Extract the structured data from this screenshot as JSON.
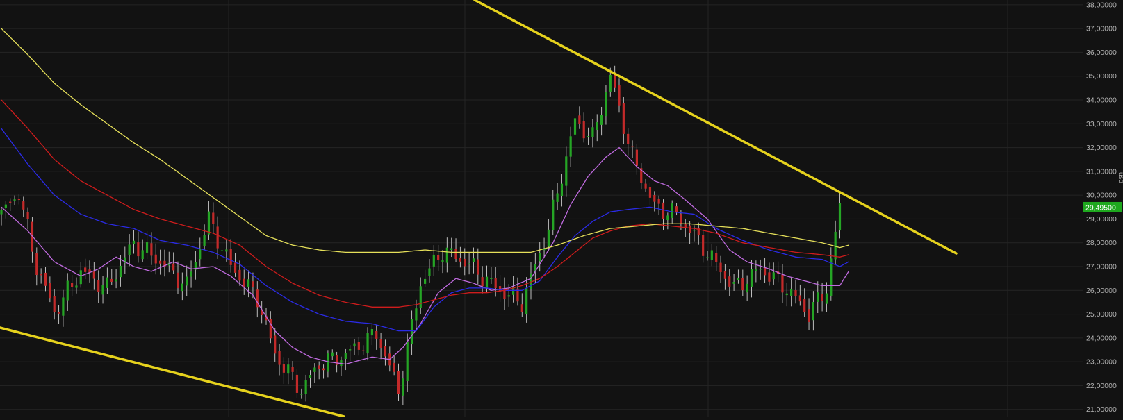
{
  "chart_data": {
    "type": "candlestick",
    "ylim": [
      20.7,
      38.2
    ],
    "grid": true,
    "y_ticks": [
      "21,00000",
      "22,00000",
      "23,00000",
      "24,00000",
      "25,00000",
      "26,00000",
      "27,00000",
      "28,00000",
      "29,00000",
      "30,00000",
      "31,00000",
      "32,00000",
      "33,00000",
      "34,00000",
      "35,00000",
      "36,00000",
      "37,00000",
      "38,00000"
    ],
    "y_tick_values": [
      21,
      22,
      23,
      24,
      25,
      26,
      27,
      28,
      29,
      30,
      31,
      32,
      33,
      34,
      35,
      36,
      37,
      38
    ],
    "currency_label": "usd",
    "last_price": {
      "label": "29,49500",
      "value": 29.495,
      "color": "#1ea81e"
    },
    "colors": {
      "up": "#25a525",
      "down": "#c32a2a",
      "grid": "#242424",
      "axis_text": "#b5b5b5",
      "background": "#121212",
      "trendline": "#e6d21d"
    },
    "bar_count": 180,
    "close_anchors": [
      [
        0,
        29.2
      ],
      [
        4,
        30.1
      ],
      [
        8,
        27.0
      ],
      [
        12,
        25.1
      ],
      [
        18,
        26.8
      ],
      [
        24,
        26.1
      ],
      [
        30,
        28.0
      ],
      [
        36,
        27.2
      ],
      [
        42,
        26.2
      ],
      [
        47,
        29.0
      ],
      [
        52,
        27.0
      ],
      [
        58,
        25.7
      ],
      [
        62,
        23.3
      ],
      [
        68,
        21.8
      ],
      [
        72,
        22.9
      ],
      [
        78,
        23.3
      ],
      [
        85,
        24.2
      ],
      [
        90,
        21.8
      ],
      [
        95,
        26.3
      ],
      [
        100,
        27.7
      ],
      [
        106,
        27.1
      ],
      [
        112,
        26.1
      ],
      [
        118,
        25.5
      ],
      [
        124,
        28.6
      ],
      [
        130,
        33.1
      ],
      [
        134,
        32.4
      ],
      [
        138,
        35.0
      ],
      [
        143,
        31.6
      ],
      [
        148,
        29.5
      ],
      [
        153,
        29.2
      ],
      [
        160,
        27.6
      ],
      [
        166,
        26.1
      ],
      [
        172,
        26.9
      ],
      [
        178,
        26.1
      ],
      [
        183,
        25.0
      ],
      [
        187,
        26.1
      ],
      [
        190,
        29.5
      ]
    ],
    "series": [
      {
        "color": "#c06be0",
        "anchors": [
          [
            0,
            29.5
          ],
          [
            6,
            28.5
          ],
          [
            12,
            27.2
          ],
          [
            18,
            26.6
          ],
          [
            22,
            26.9
          ],
          [
            26,
            27.4
          ],
          [
            30,
            27.0
          ],
          [
            34,
            26.8
          ],
          [
            39,
            27.2
          ],
          [
            43,
            26.9
          ],
          [
            48,
            27.0
          ],
          [
            52,
            26.6
          ],
          [
            57,
            25.8
          ],
          [
            62,
            24.3
          ],
          [
            66,
            23.6
          ],
          [
            70,
            23.2
          ],
          [
            74,
            23.0
          ],
          [
            78,
            22.9
          ],
          [
            84,
            23.2
          ],
          [
            88,
            23.1
          ],
          [
            91,
            23.6
          ],
          [
            95,
            24.6
          ],
          [
            99,
            25.9
          ],
          [
            103,
            26.5
          ],
          [
            107,
            26.3
          ],
          [
            111,
            26.0
          ],
          [
            115,
            26.1
          ],
          [
            120,
            26.5
          ],
          [
            125,
            28.0
          ],
          [
            129,
            29.6
          ],
          [
            133,
            30.8
          ],
          [
            137,
            31.6
          ],
          [
            140,
            32.0
          ],
          [
            144,
            31.2
          ],
          [
            148,
            30.6
          ],
          [
            151,
            30.4
          ],
          [
            155,
            29.8
          ],
          [
            160,
            29.0
          ],
          [
            165,
            27.7
          ],
          [
            169,
            27.2
          ],
          [
            174,
            26.9
          ],
          [
            178,
            26.6
          ],
          [
            182,
            26.4
          ],
          [
            186,
            26.2
          ],
          [
            190,
            26.2
          ],
          [
            192,
            26.8
          ]
        ]
      },
      {
        "color": "#2b2be6",
        "anchors": [
          [
            0,
            32.8
          ],
          [
            6,
            31.3
          ],
          [
            12,
            30.0
          ],
          [
            18,
            29.2
          ],
          [
            24,
            28.8
          ],
          [
            30,
            28.6
          ],
          [
            36,
            28.1
          ],
          [
            42,
            27.9
          ],
          [
            48,
            27.6
          ],
          [
            54,
            27.1
          ],
          [
            60,
            26.2
          ],
          [
            66,
            25.5
          ],
          [
            72,
            25.0
          ],
          [
            78,
            24.7
          ],
          [
            84,
            24.6
          ],
          [
            90,
            24.3
          ],
          [
            94,
            24.3
          ],
          [
            98,
            25.3
          ],
          [
            102,
            25.9
          ],
          [
            106,
            26.1
          ],
          [
            110,
            26.1
          ],
          [
            114,
            26.0
          ],
          [
            118,
            26.0
          ],
          [
            122,
            26.4
          ],
          [
            126,
            27.4
          ],
          [
            130,
            28.3
          ],
          [
            134,
            28.9
          ],
          [
            138,
            29.3
          ],
          [
            142,
            29.4
          ],
          [
            147,
            29.5
          ],
          [
            152,
            29.3
          ],
          [
            157,
            29.2
          ],
          [
            162,
            28.6
          ],
          [
            168,
            28.1
          ],
          [
            174,
            27.7
          ],
          [
            180,
            27.4
          ],
          [
            186,
            27.3
          ],
          [
            190,
            27.0
          ],
          [
            192,
            27.2
          ]
        ]
      },
      {
        "color": "#cf1c1c",
        "anchors": [
          [
            0,
            34.0
          ],
          [
            6,
            32.8
          ],
          [
            12,
            31.5
          ],
          [
            18,
            30.6
          ],
          [
            24,
            30.0
          ],
          [
            30,
            29.4
          ],
          [
            36,
            29.0
          ],
          [
            42,
            28.7
          ],
          [
            48,
            28.4
          ],
          [
            54,
            27.9
          ],
          [
            60,
            27.0
          ],
          [
            66,
            26.3
          ],
          [
            72,
            25.8
          ],
          [
            78,
            25.5
          ],
          [
            84,
            25.3
          ],
          [
            90,
            25.3
          ],
          [
            94,
            25.4
          ],
          [
            98,
            25.6
          ],
          [
            102,
            25.8
          ],
          [
            106,
            25.9
          ],
          [
            110,
            25.9
          ],
          [
            114,
            26.0
          ],
          [
            118,
            26.2
          ],
          [
            122,
            26.5
          ],
          [
            126,
            27.0
          ],
          [
            130,
            27.6
          ],
          [
            134,
            28.2
          ],
          [
            138,
            28.5
          ],
          [
            142,
            28.7
          ],
          [
            147,
            28.8
          ],
          [
            152,
            28.7
          ],
          [
            157,
            28.6
          ],
          [
            162,
            28.4
          ],
          [
            168,
            28.0
          ],
          [
            174,
            27.8
          ],
          [
            180,
            27.6
          ],
          [
            186,
            27.5
          ],
          [
            190,
            27.4
          ],
          [
            192,
            27.5
          ]
        ]
      },
      {
        "color": "#e6e05a",
        "anchors": [
          [
            0,
            37.0
          ],
          [
            6,
            35.9
          ],
          [
            12,
            34.7
          ],
          [
            18,
            33.8
          ],
          [
            24,
            33.0
          ],
          [
            30,
            32.2
          ],
          [
            36,
            31.5
          ],
          [
            42,
            30.7
          ],
          [
            48,
            29.9
          ],
          [
            54,
            29.1
          ],
          [
            60,
            28.3
          ],
          [
            66,
            27.9
          ],
          [
            72,
            27.7
          ],
          [
            78,
            27.6
          ],
          [
            84,
            27.6
          ],
          [
            90,
            27.6
          ],
          [
            96,
            27.7
          ],
          [
            102,
            27.6
          ],
          [
            108,
            27.6
          ],
          [
            114,
            27.6
          ],
          [
            120,
            27.6
          ],
          [
            126,
            27.9
          ],
          [
            132,
            28.3
          ],
          [
            138,
            28.6
          ],
          [
            144,
            28.7
          ],
          [
            150,
            28.8
          ],
          [
            156,
            28.8
          ],
          [
            162,
            28.7
          ],
          [
            168,
            28.6
          ],
          [
            174,
            28.4
          ],
          [
            180,
            28.2
          ],
          [
            186,
            28.0
          ],
          [
            190,
            27.8
          ],
          [
            192,
            27.9
          ]
        ]
      }
    ]
  }
}
